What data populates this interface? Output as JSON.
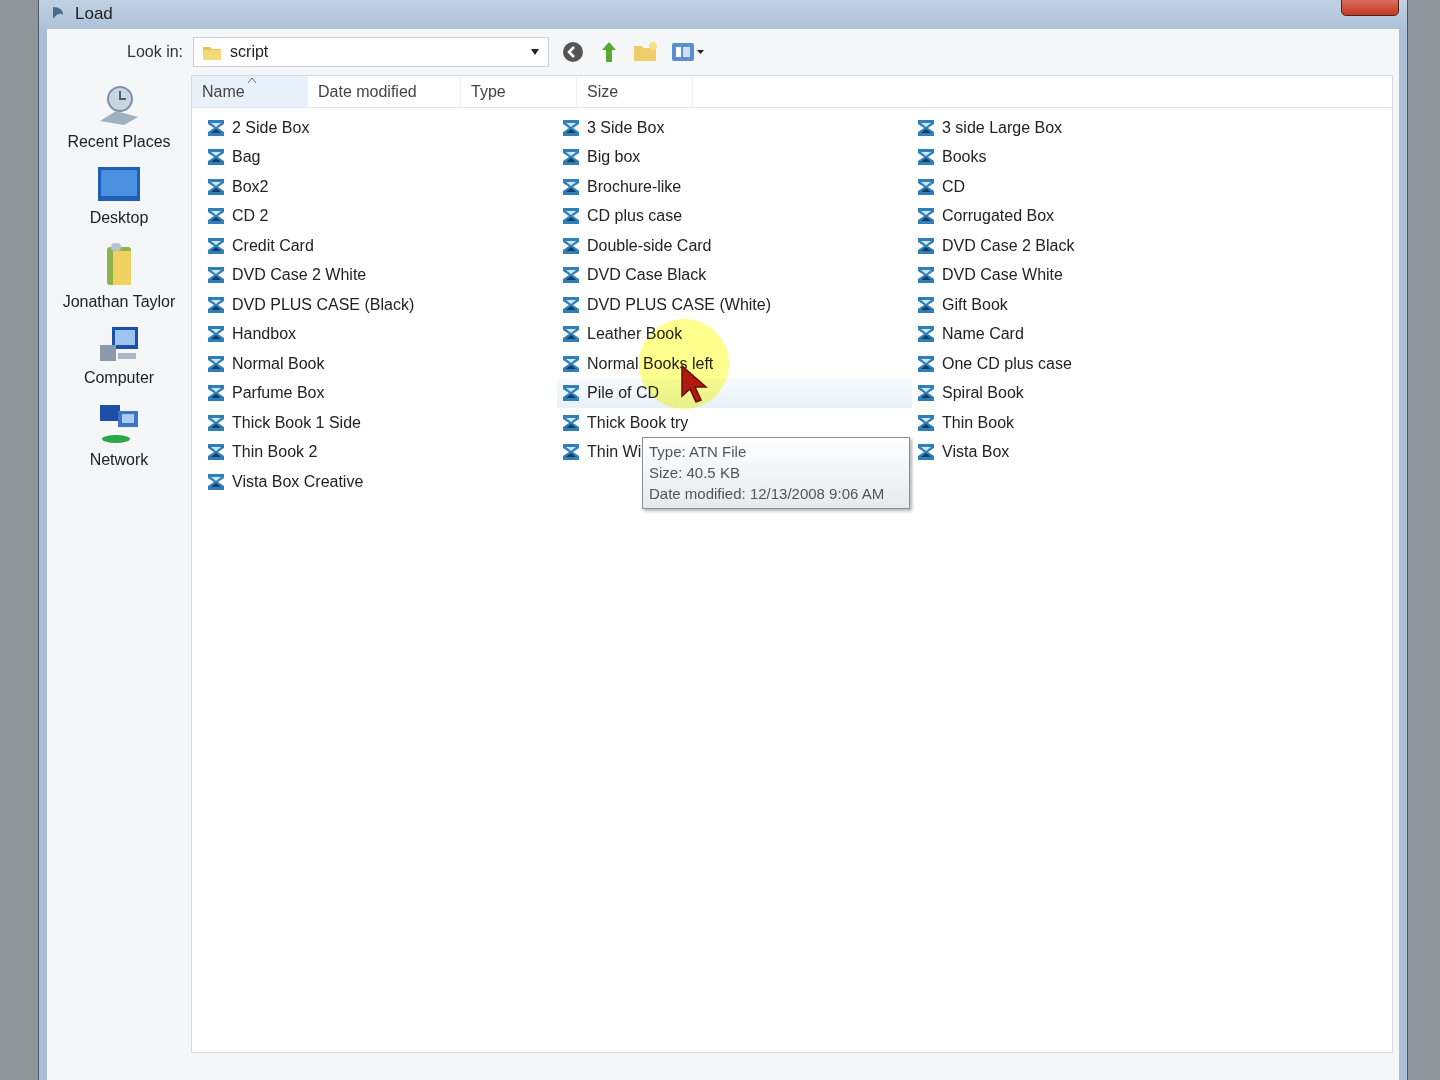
{
  "window": {
    "title": "Load"
  },
  "toolbar": {
    "look_in_label": "Look in:",
    "folder": "script"
  },
  "places": [
    {
      "kind": "recent",
      "label": "Recent Places"
    },
    {
      "kind": "desktop",
      "label": "Desktop"
    },
    {
      "kind": "user",
      "label": "Jonathan Taylor"
    },
    {
      "kind": "computer",
      "label": "Computer"
    },
    {
      "kind": "network",
      "label": "Network"
    }
  ],
  "columns": [
    {
      "label": "Name",
      "sorted": true
    },
    {
      "label": "Date modified",
      "sorted": false
    },
    {
      "label": "Type",
      "sorted": false
    },
    {
      "label": "Size",
      "sorted": false
    }
  ],
  "file_columns": [
    {
      "files": [
        {
          "name": "2 Side Box",
          "hovered": false
        },
        {
          "name": "Bag",
          "hovered": false
        },
        {
          "name": "Box2",
          "hovered": false
        },
        {
          "name": "CD 2",
          "hovered": false
        },
        {
          "name": "Credit Card",
          "hovered": false
        },
        {
          "name": "DVD Case 2 White",
          "hovered": false
        },
        {
          "name": "DVD PLUS CASE (Black)",
          "hovered": false
        },
        {
          "name": "Handbox",
          "hovered": false
        },
        {
          "name": "Normal Book",
          "hovered": false
        },
        {
          "name": "Parfume Box",
          "hovered": false
        },
        {
          "name": "Thick Book 1 Side",
          "hovered": false
        },
        {
          "name": "Thin Book 2",
          "hovered": false
        },
        {
          "name": "Vista Box Creative",
          "hovered": false
        }
      ]
    },
    {
      "files": [
        {
          "name": "3 Side Box",
          "hovered": false
        },
        {
          "name": "Big box",
          "hovered": false
        },
        {
          "name": "Brochure-like",
          "hovered": false
        },
        {
          "name": "CD plus case",
          "hovered": false
        },
        {
          "name": "Double-side Card",
          "hovered": false
        },
        {
          "name": "DVD Case Black",
          "hovered": false
        },
        {
          "name": "DVD PLUS CASE (White)",
          "hovered": false
        },
        {
          "name": "Leather Book",
          "hovered": false
        },
        {
          "name": "Normal Books left",
          "hovered": false
        },
        {
          "name": "Pile of CD",
          "hovered": true
        },
        {
          "name": "Thick Book try",
          "hovered": false
        },
        {
          "name": "Thin Wi",
          "hovered": false
        }
      ]
    },
    {
      "files": [
        {
          "name": "3 side Large Box",
          "hovered": false
        },
        {
          "name": "Books",
          "hovered": false
        },
        {
          "name": "CD",
          "hovered": false
        },
        {
          "name": "Corrugated Box",
          "hovered": false
        },
        {
          "name": "DVD Case 2 Black",
          "hovered": false
        },
        {
          "name": "DVD Case White",
          "hovered": false
        },
        {
          "name": "Gift Book",
          "hovered": false
        },
        {
          "name": "Name Card",
          "hovered": false
        },
        {
          "name": "One CD plus case",
          "hovered": false
        },
        {
          "name": "Spiral Book",
          "hovered": false
        },
        {
          "name": "Thin Book",
          "hovered": false
        },
        {
          "name": "Vista Box",
          "hovered": false
        }
      ]
    }
  ],
  "tooltip": {
    "lines": [
      "Type: ATN File",
      "Size: 40.5 KB",
      "Date modified: 12/13/2008 9:06 AM"
    ]
  }
}
